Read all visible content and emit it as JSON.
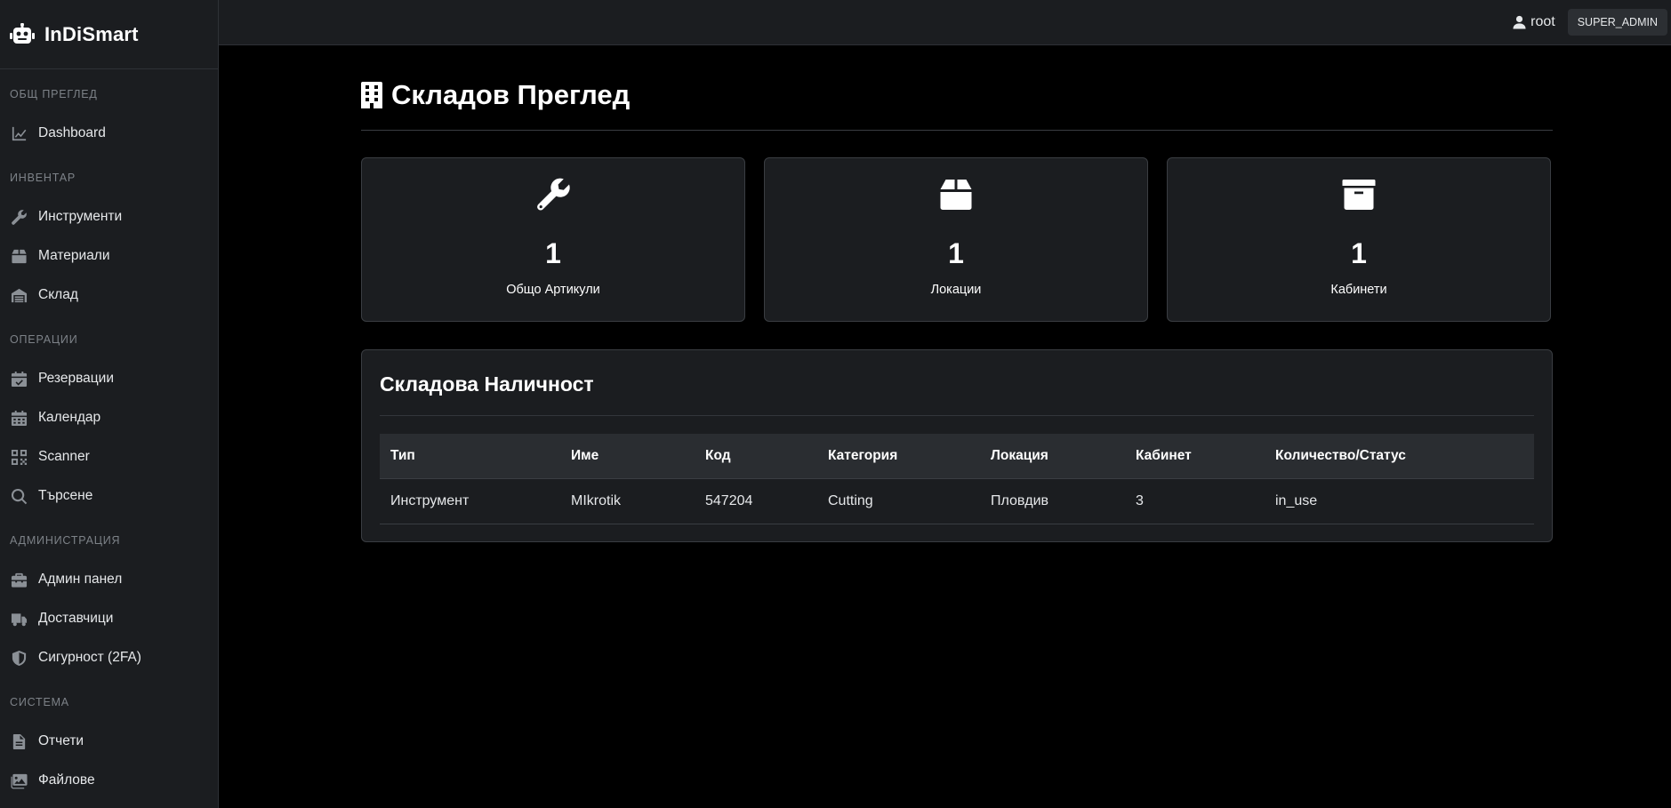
{
  "app": {
    "name": "InDiSmart",
    "icon": "robot-icon"
  },
  "topbar": {
    "user_name": "root",
    "user_icon": "user-icon",
    "role": "SUPER_ADMIN"
  },
  "sidebar": {
    "sections": [
      {
        "title": "ОБЩ ПРЕГЛЕД",
        "items": [
          {
            "label": "Dashboard",
            "icon": "chart-line-icon"
          }
        ]
      },
      {
        "title": "ИНВЕНТАР",
        "items": [
          {
            "label": "Инструменти",
            "icon": "wrench-icon"
          },
          {
            "label": "Материали",
            "icon": "box-icon"
          },
          {
            "label": "Склад",
            "icon": "warehouse-icon"
          }
        ]
      },
      {
        "title": "ОПЕРАЦИИ",
        "items": [
          {
            "label": "Резервации",
            "icon": "calendar-check-icon"
          },
          {
            "label": "Календар",
            "icon": "calendar-icon"
          },
          {
            "label": "Scanner",
            "icon": "qrcode-icon"
          },
          {
            "label": "Търсене",
            "icon": "search-icon"
          }
        ]
      },
      {
        "title": "АДМИНИСТРАЦИЯ",
        "items": [
          {
            "label": "Админ панел",
            "icon": "toolbox-icon"
          },
          {
            "label": "Доставчици",
            "icon": "truck-icon"
          },
          {
            "label": "Сигурност (2FA)",
            "icon": "shield-icon"
          }
        ]
      },
      {
        "title": "СИСТЕМА",
        "items": [
          {
            "label": "Отчети",
            "icon": "file-icon"
          },
          {
            "label": "Файлове",
            "icon": "images-icon"
          }
        ]
      }
    ]
  },
  "page": {
    "title": "Складов Преглед",
    "title_icon": "building-icon"
  },
  "stats": [
    {
      "value": "1",
      "label": "Общо Артикули",
      "icon": "wrench-icon"
    },
    {
      "value": "1",
      "label": "Локации",
      "icon": "box-icon"
    },
    {
      "value": "1",
      "label": "Кабинети",
      "icon": "archive-icon"
    }
  ],
  "inventory": {
    "title": "Складова Наличност",
    "columns": [
      "Тип",
      "Име",
      "Код",
      "Категория",
      "Локация",
      "Кабинет",
      "Количество/Статус"
    ],
    "rows": [
      [
        "Инструмент",
        "MIkrotik",
        "547204",
        "Cutting",
        "Пловдив",
        "3",
        "in_use"
      ]
    ]
  },
  "colors": {
    "background": "#000000",
    "panel": "#1b1d20",
    "border": "#3a3d42",
    "muted_text": "#7d8288"
  }
}
